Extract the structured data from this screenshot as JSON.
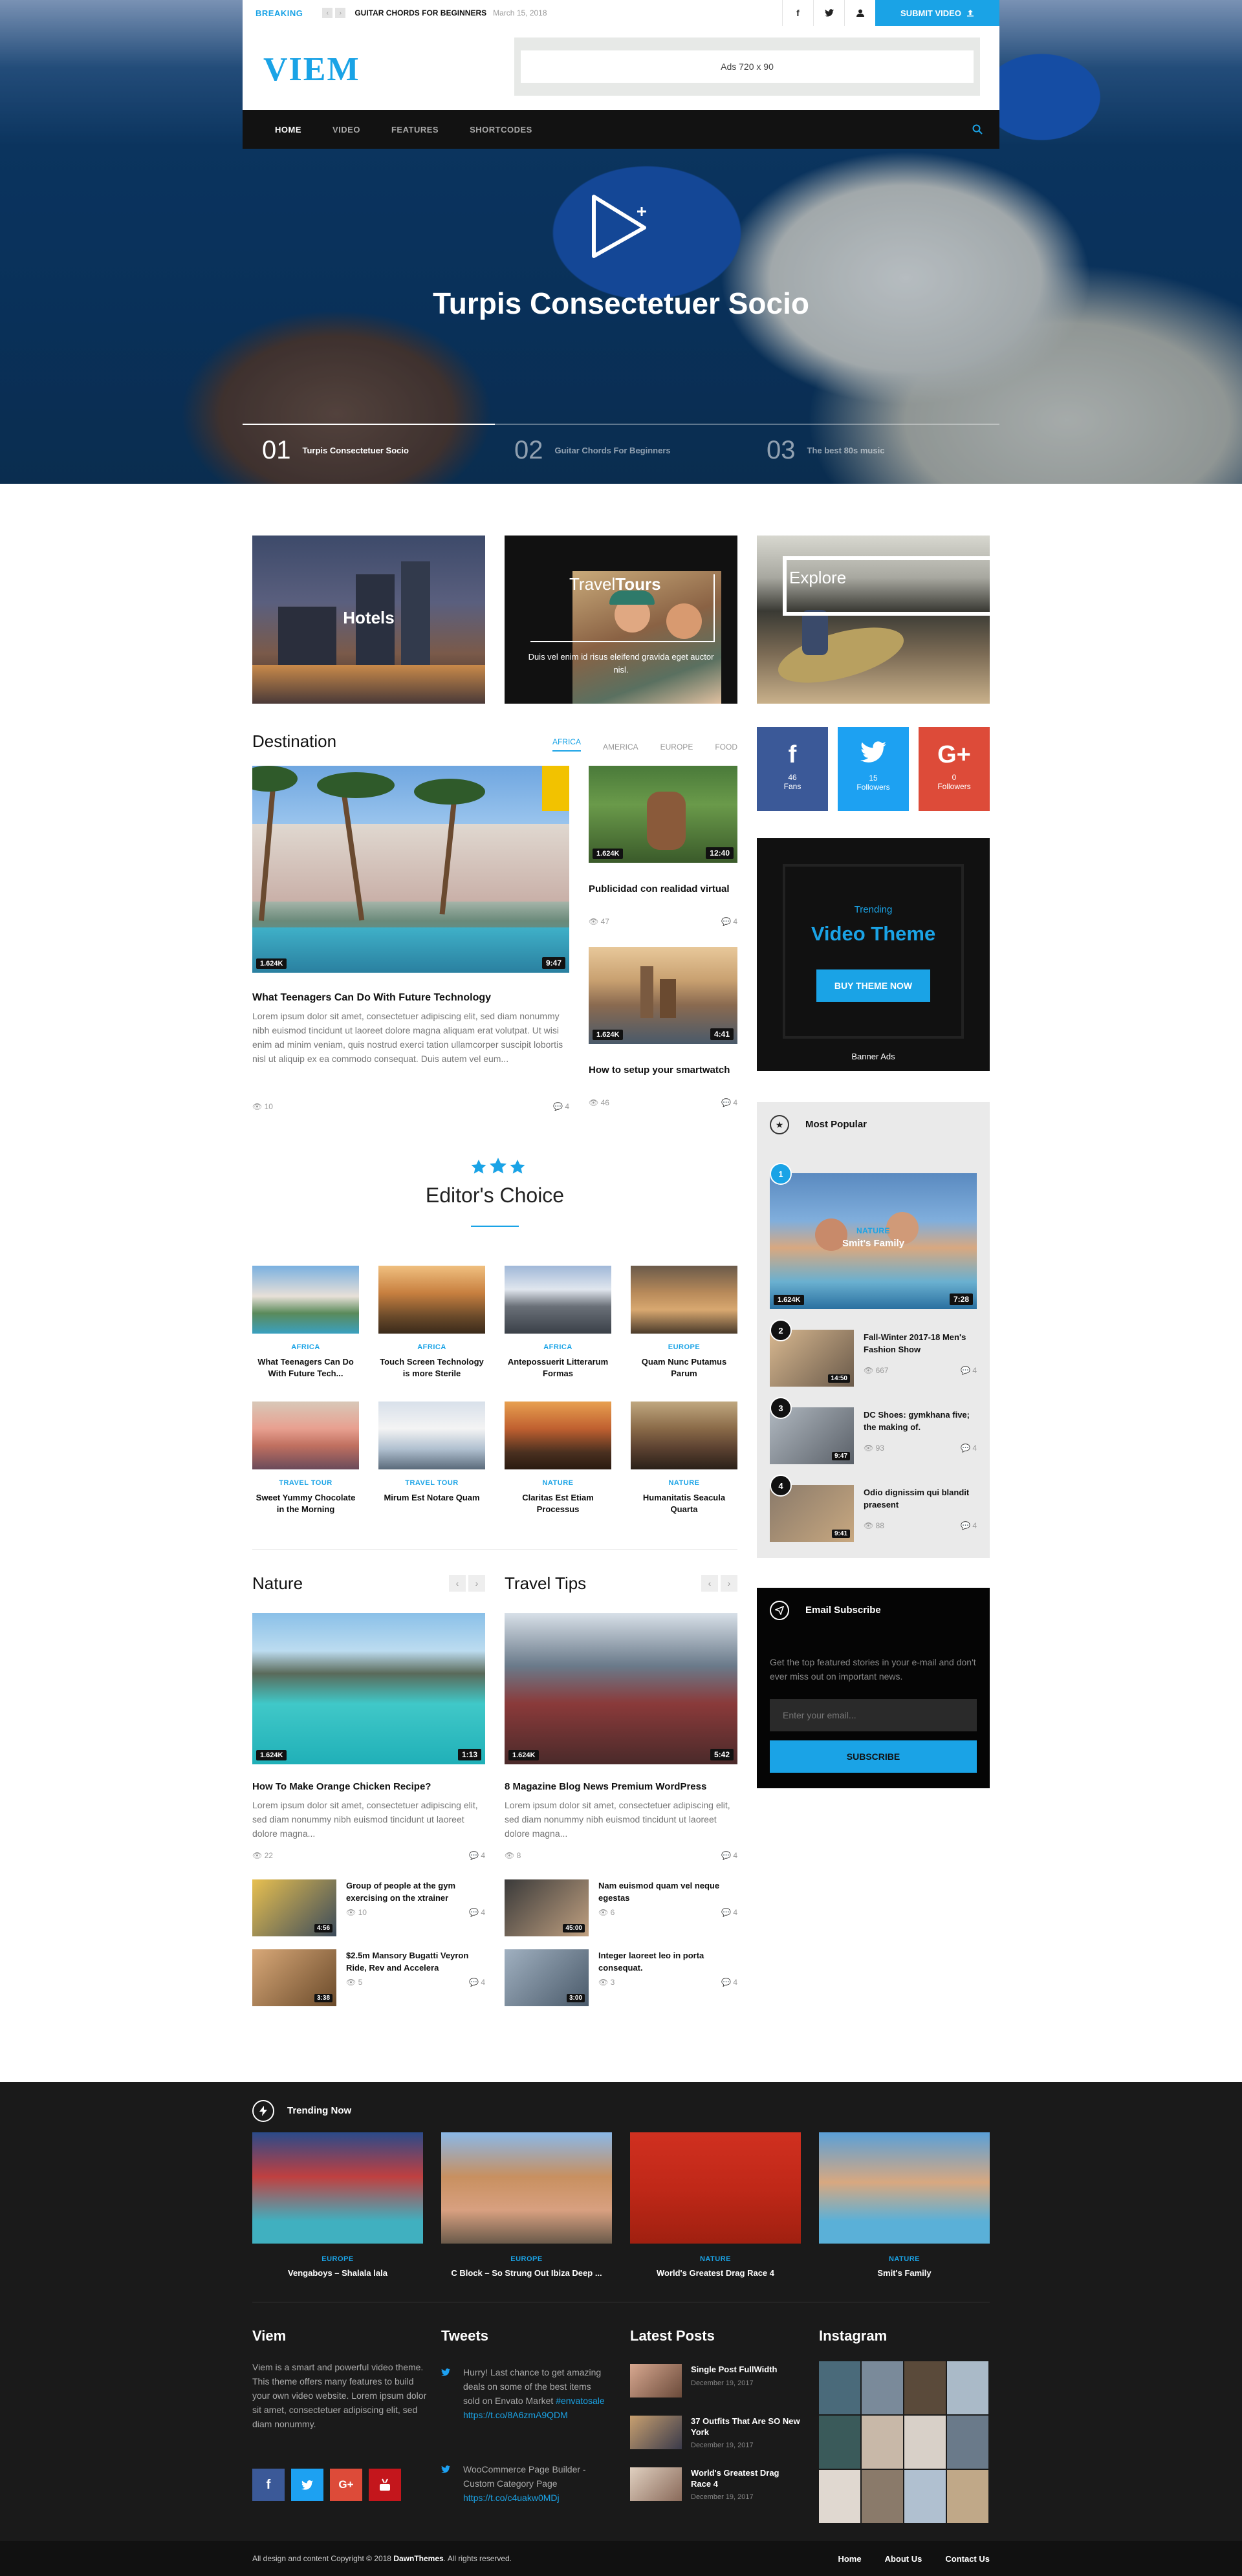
{
  "topbar": {
    "breaking_label": "BREAKING",
    "breaking_title": "GUITAR CHORDS FOR BEGINNERS",
    "breaking_date": "March 15, 2018",
    "submit_label": "SUBMIT VIDEO"
  },
  "header": {
    "logo": "VIEM",
    "ad_text": "Ads 720 x 90"
  },
  "nav": {
    "items": [
      "HOME",
      "VIDEO",
      "FEATURES",
      "SHORTCODES"
    ]
  },
  "hero": {
    "title": "Turpis Consectetuer Socio",
    "slides": [
      {
        "num": "01",
        "title": "Turpis Consectetuer Socio"
      },
      {
        "num": "02",
        "title": "Guitar Chords For Beginners"
      },
      {
        "num": "03",
        "title": "The best 80s music"
      }
    ]
  },
  "categories": {
    "hotels": "Hotels",
    "travel_a": "Travel",
    "travel_b": "Tours",
    "travel_desc": "Duis vel enim id risus eleifend gravida eget auctor nisl.",
    "explore": "Explore"
  },
  "destination": {
    "title": "Destination",
    "filters": [
      "AFRICA",
      "AMERICA",
      "EUROPE",
      "FOOD"
    ],
    "main": {
      "views": "1.624K",
      "duration": "9:47",
      "title": "What Teenagers Can Do With Future Technology",
      "excerpt": "Lorem ipsum dolor sit amet, consectetuer adipiscing elit, sed diam nonummy nibh euismod tincidunt ut laoreet dolore magna aliquam erat volutpat. Ut wisi enim ad minim veniam, quis nostrud exerci tation ullamcorper suscipit lobortis nisl ut aliquip ex ea commodo consequat. Duis autem vel eum...",
      "views_count": "10",
      "comments": "4"
    },
    "side": [
      {
        "views": "1.624K",
        "duration": "12:40",
        "title": "Publicidad con realidad virtual",
        "views_count": "47",
        "comments": "4"
      },
      {
        "views": "1.624K",
        "duration": "4:41",
        "title": "How to setup your smartwatch",
        "views_count": "46",
        "comments": "4"
      }
    ]
  },
  "editors": {
    "title": "Editor's Choice",
    "items": [
      {
        "cat": "AFRICA",
        "title": "What Teenagers Can Do With Future Tech..."
      },
      {
        "cat": "AFRICA",
        "title": "Touch Screen Technology is more Sterile"
      },
      {
        "cat": "AFRICA",
        "title": "Antepossuerit Litterarum Formas"
      },
      {
        "cat": "EUROPE",
        "title": "Quam Nunc Putamus Parum"
      },
      {
        "cat": "TRAVEL TOUR",
        "title": "Sweet Yummy Chocolate in the Morning"
      },
      {
        "cat": "TRAVEL TOUR",
        "title": "Mirum Est Notare Quam"
      },
      {
        "cat": "NATURE",
        "title": "Claritas Est Etiam Processus"
      },
      {
        "cat": "NATURE",
        "title": "Humanitatis Seacula Quarta"
      }
    ]
  },
  "nature": {
    "title": "Nature",
    "main": {
      "views": "1.624K",
      "duration": "1:13",
      "title": "How To Make Orange Chicken Recipe?",
      "excerpt": "Lorem ipsum dolor sit amet, consectetuer adipiscing elit, sed diam nonummy nibh euismod tincidunt ut laoreet dolore magna...",
      "views_count": "22",
      "comments": "4"
    },
    "list": [
      {
        "duration": "4:56",
        "title": "Group of people at the gym exercising on the xtrainer",
        "views_count": "10",
        "comments": "4"
      },
      {
        "duration": "3:38",
        "title": "$2.5m Mansory Bugatti Veyron Ride, Rev and Accelera",
        "views_count": "5",
        "comments": "4"
      }
    ]
  },
  "travel_tips": {
    "title": "Travel Tips",
    "main": {
      "views": "1.624K",
      "duration": "5:42",
      "title": "8 Magazine Blog News Premium WordPress",
      "excerpt": "Lorem ipsum dolor sit amet, consectetuer adipiscing elit, sed diam nonummy nibh euismod tincidunt ut laoreet dolore magna...",
      "views_count": "8",
      "comments": "4"
    },
    "list": [
      {
        "duration": "45:00",
        "title": "Nam euismod quam vel neque egestas",
        "views_count": "6",
        "comments": "4"
      },
      {
        "duration": "3:00",
        "title": "Integer laoreet leo in porta consequat.",
        "views_count": "3",
        "comments": "4"
      }
    ]
  },
  "social": {
    "facebook": {
      "count": "46",
      "label": "Fans"
    },
    "twitter": {
      "count": "15",
      "label": "Followers"
    },
    "google": {
      "count": "0",
      "label": "Followers"
    }
  },
  "banner": {
    "small": "Trending",
    "big": "Video Theme",
    "button": "BUY THEME NOW",
    "caption": "Banner Ads"
  },
  "popular": {
    "title": "Most Popular",
    "featured": {
      "rank": "1",
      "cat": "NATURE",
      "title": "Smit's Family",
      "views": "1.624K",
      "duration": "7:28"
    },
    "items": [
      {
        "rank": "2",
        "duration": "14:50",
        "title": "Fall-Winter 2017-18 Men's Fashion Show",
        "views_count": "667",
        "comments": "4"
      },
      {
        "rank": "3",
        "duration": "9:47",
        "title": "DC Shoes: gymkhana five; the making of.",
        "views_count": "93",
        "comments": "4"
      },
      {
        "rank": "4",
        "duration": "9:41",
        "title": "Odio dignissim qui blandit praesent",
        "views_count": "88",
        "comments": "4"
      }
    ]
  },
  "email": {
    "title": "Email Subscribe",
    "text": "Get the top featured stories in your e-mail and don't ever miss out on important news.",
    "placeholder": "Enter your email...",
    "button": "SUBSCRIBE"
  },
  "trending": {
    "title": "Trending Now",
    "items": [
      {
        "cat": "EUROPE",
        "title": "Vengaboys – Shalala lala"
      },
      {
        "cat": "EUROPE",
        "title": "C Block – So Strung Out Ibiza Deep ..."
      },
      {
        "cat": "NATURE",
        "title": "World's Greatest Drag Race 4"
      },
      {
        "cat": "NATURE",
        "title": "Smit's Family"
      }
    ]
  },
  "footer": {
    "about_title": "Viem",
    "about_text": "Viem is a smart and powerful video theme. This theme offers many features to build your own video website. Lorem ipsum dolor sit amet, consectetuer adipiscing elit, sed diam nonummy.",
    "tweets_title": "Tweets",
    "tweets": [
      {
        "text": "Hurry! Last chance to get amazing deals on some of the best items sold on Envato Market ",
        "tag": "#envatosale",
        "link": "https://t.co/8A6zmA9QDM"
      },
      {
        "text": "WooCommerce Page Builder - Custom Category Page ",
        "tag": "",
        "link": "https://t.co/c4uakw0MDj"
      }
    ],
    "posts_title": "Latest Posts",
    "posts": [
      {
        "title": "Single Post FullWidth",
        "date": "December 19, 2017"
      },
      {
        "title": "37 Outfits That Are SO New York",
        "date": "December 19, 2017"
      },
      {
        "title": "World's Greatest Drag Race 4",
        "date": "December 19, 2017"
      }
    ],
    "instagram_title": "Instagram",
    "copyright_pre": "All design and content Copyright © 2018 ",
    "copyright_brand": "DawnThemes",
    "copyright_post": ". All rights reserved.",
    "links": [
      "Home",
      "About Us",
      "Contact Us"
    ]
  },
  "colors": {
    "accent": "#1aa3e6",
    "facebook": "#3b5998",
    "twitter": "#1da1f2",
    "google": "#dd4b39"
  }
}
